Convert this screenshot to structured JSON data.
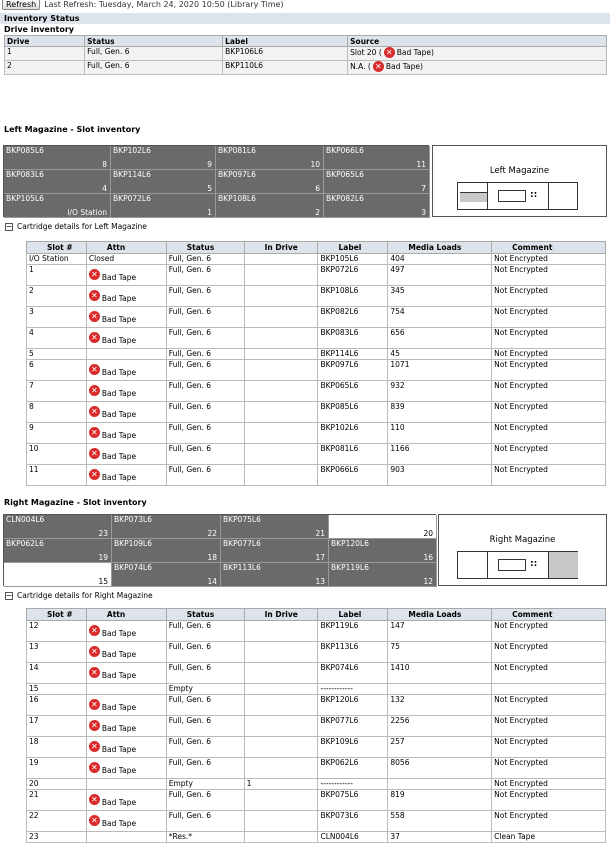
{
  "header": {
    "refresh_label": "Refresh",
    "last_refresh": "Last Refresh: Tuesday, March 24, 2020 10:50 (Library Time)"
  },
  "inventory_status": "Inventory Status",
  "drive_inventory": {
    "title": "Drive inventory",
    "columns": [
      "Drive",
      "Status",
      "Label",
      "Source"
    ],
    "rows": [
      {
        "drive": "1",
        "status": "Full, Gen. 6",
        "label": "BKP106L6",
        "source": "Slot 20 (",
        "attn": "Bad Tape)"
      },
      {
        "drive": "2",
        "status": "Full, Gen. 6",
        "label": "BKP110L6",
        "source": "N.A. (",
        "attn": "Bad Tape)"
      }
    ]
  },
  "left_magazine": {
    "title": "Left Magazine - Slot inventory",
    "name": "Left Magazine",
    "slots": [
      {
        "label": "BKP085L6",
        "num": "8",
        "filled": true
      },
      {
        "label": "BKP102L6",
        "num": "9",
        "filled": true
      },
      {
        "label": "BKP081L6",
        "num": "10",
        "filled": true
      },
      {
        "label": "BKP066L6",
        "num": "11",
        "filled": true
      },
      {
        "label": "BKP083L6",
        "num": "4",
        "filled": true
      },
      {
        "label": "BKP114L6",
        "num": "5",
        "filled": true
      },
      {
        "label": "BKP097L6",
        "num": "6",
        "filled": true
      },
      {
        "label": "BKP065L6",
        "num": "7",
        "filled": true
      },
      {
        "label": "BKP105L6",
        "num": "I/O Station",
        "filled": true
      },
      {
        "label": "BKP072L6",
        "num": "1",
        "filled": true
      },
      {
        "label": "BKP108L6",
        "num": "2",
        "filled": true
      },
      {
        "label": "BKP082L6",
        "num": "3",
        "filled": true
      }
    ],
    "details_toggle": "Cartridge details for Left Magazine",
    "columns": [
      "Slot #",
      "Attn",
      "Status",
      "In Drive",
      "Label",
      "Media Loads",
      "Comment"
    ],
    "rows": [
      {
        "slot": "I/O Station",
        "attn": "Closed",
        "bad": false,
        "status": "Full, Gen. 6",
        "drive": "",
        "label": "BKP105L6",
        "loads": "404",
        "comment": "Not Encrypted"
      },
      {
        "slot": "1",
        "attn": "Bad Tape",
        "bad": true,
        "status": "Full, Gen. 6",
        "drive": "",
        "label": "BKP072L6",
        "loads": "497",
        "comment": "Not Encrypted"
      },
      {
        "slot": "2",
        "attn": "Bad Tape",
        "bad": true,
        "status": "Full, Gen. 6",
        "drive": "",
        "label": "BKP108L6",
        "loads": "345",
        "comment": "Not Encrypted"
      },
      {
        "slot": "3",
        "attn": "Bad Tape",
        "bad": true,
        "status": "Full, Gen. 6",
        "drive": "",
        "label": "BKP082L6",
        "loads": "754",
        "comment": "Not Encrypted"
      },
      {
        "slot": "4",
        "attn": "Bad Tape",
        "bad": true,
        "status": "Full, Gen. 6",
        "drive": "",
        "label": "BKP083L6",
        "loads": "656",
        "comment": "Not Encrypted"
      },
      {
        "slot": "5",
        "attn": "",
        "bad": false,
        "status": "Full, Gen. 6",
        "drive": "",
        "label": "BKP114L6",
        "loads": "45",
        "comment": "Not Encrypted"
      },
      {
        "slot": "6",
        "attn": "Bad Tape",
        "bad": true,
        "status": "Full, Gen. 6",
        "drive": "",
        "label": "BKP097L6",
        "loads": "1071",
        "comment": "Not Encrypted"
      },
      {
        "slot": "7",
        "attn": "Bad Tape",
        "bad": true,
        "status": "Full, Gen. 6",
        "drive": "",
        "label": "BKP065L6",
        "loads": "932",
        "comment": "Not Encrypted"
      },
      {
        "slot": "8",
        "attn": "Bad Tape",
        "bad": true,
        "status": "Full, Gen. 6",
        "drive": "",
        "label": "BKP085L6",
        "loads": "839",
        "comment": "Not Encrypted"
      },
      {
        "slot": "9",
        "attn": "Bad Tape",
        "bad": true,
        "status": "Full, Gen. 6",
        "drive": "",
        "label": "BKP102L6",
        "loads": "110",
        "comment": "Not Encrypted"
      },
      {
        "slot": "10",
        "attn": "Bad Tape",
        "bad": true,
        "status": "Full, Gen. 6",
        "drive": "",
        "label": "BKP081L6",
        "loads": "1166",
        "comment": "Not Encrypted"
      },
      {
        "slot": "11",
        "attn": "Bad Tape",
        "bad": true,
        "status": "Full, Gen. 6",
        "drive": "",
        "label": "BKP066L6",
        "loads": "903",
        "comment": "Not Encrypted"
      }
    ]
  },
  "right_magazine": {
    "title": "Right Magazine - Slot inventory",
    "name": "Right Magazine",
    "slots": [
      {
        "label": "CLN004L6",
        "num": "23",
        "filled": true
      },
      {
        "label": "BKP073L6",
        "num": "22",
        "filled": true
      },
      {
        "label": "BKP075L6",
        "num": "21",
        "filled": true
      },
      {
        "label": "",
        "num": "20",
        "filled": false
      },
      {
        "label": "BKP062L6",
        "num": "19",
        "filled": true
      },
      {
        "label": "BKP109L6",
        "num": "18",
        "filled": true
      },
      {
        "label": "BKP077L6",
        "num": "17",
        "filled": true
      },
      {
        "label": "BKP120L6",
        "num": "16",
        "filled": true
      },
      {
        "label": "",
        "num": "15",
        "filled": false
      },
      {
        "label": "BKP074L6",
        "num": "14",
        "filled": true
      },
      {
        "label": "BKP113L6",
        "num": "13",
        "filled": true
      },
      {
        "label": "BKP119L6",
        "num": "12",
        "filled": true
      }
    ],
    "details_toggle": "Cartridge details for Right Magazine",
    "columns": [
      "Slot #",
      "Attn",
      "Status",
      "In Drive",
      "Label",
      "Media Loads",
      "Comment"
    ],
    "rows": [
      {
        "slot": "12",
        "attn": "Bad Tape",
        "bad": true,
        "status": "Full, Gen. 6",
        "drive": "",
        "label": "BKP119L6",
        "loads": "147",
        "comment": "Not Encrypted"
      },
      {
        "slot": "13",
        "attn": "Bad Tape",
        "bad": true,
        "status": "Full, Gen. 6",
        "drive": "",
        "label": "BKP113L6",
        "loads": "75",
        "comment": "Not Encrypted"
      },
      {
        "slot": "14",
        "attn": "Bad Tape",
        "bad": true,
        "status": "Full, Gen. 6",
        "drive": "",
        "label": "BKP074L6",
        "loads": "1410",
        "comment": "Not Encrypted"
      },
      {
        "slot": "15",
        "attn": "",
        "bad": false,
        "status": "Empty",
        "drive": "",
        "label": "------------",
        "loads": "",
        "comment": ""
      },
      {
        "slot": "16",
        "attn": "Bad Tape",
        "bad": true,
        "status": "Full, Gen. 6",
        "drive": "",
        "label": "BKP120L6",
        "loads": "132",
        "comment": "Not Encrypted"
      },
      {
        "slot": "17",
        "attn": "Bad Tape",
        "bad": true,
        "status": "Full, Gen. 6",
        "drive": "",
        "label": "BKP077L6",
        "loads": "2256",
        "comment": "Not Encrypted"
      },
      {
        "slot": "18",
        "attn": "Bad Tape",
        "bad": true,
        "status": "Full, Gen. 6",
        "drive": "",
        "label": "BKP109L6",
        "loads": "257",
        "comment": "Not Encrypted"
      },
      {
        "slot": "19",
        "attn": "Bad Tape",
        "bad": true,
        "status": "Full, Gen. 6",
        "drive": "",
        "label": "BKP062L6",
        "loads": "8056",
        "comment": "Not Encrypted"
      },
      {
        "slot": "20",
        "attn": "",
        "bad": false,
        "status": "Empty",
        "drive": "1",
        "label": "------------",
        "loads": "",
        "comment": "Not Encrypted"
      },
      {
        "slot": "21",
        "attn": "Bad Tape",
        "bad": true,
        "status": "Full, Gen. 6",
        "drive": "",
        "label": "BKP075L6",
        "loads": "819",
        "comment": "Not Encrypted"
      },
      {
        "slot": "22",
        "attn": "Bad Tape",
        "bad": true,
        "status": "Full, Gen. 6",
        "drive": "",
        "label": "BKP073L6",
        "loads": "558",
        "comment": "Not Encrypted"
      },
      {
        "slot": "23",
        "attn": "",
        "bad": false,
        "status": "*Res.*",
        "drive": "",
        "label": "CLN004L6",
        "loads": "37",
        "comment": "Clean Tape"
      }
    ]
  }
}
